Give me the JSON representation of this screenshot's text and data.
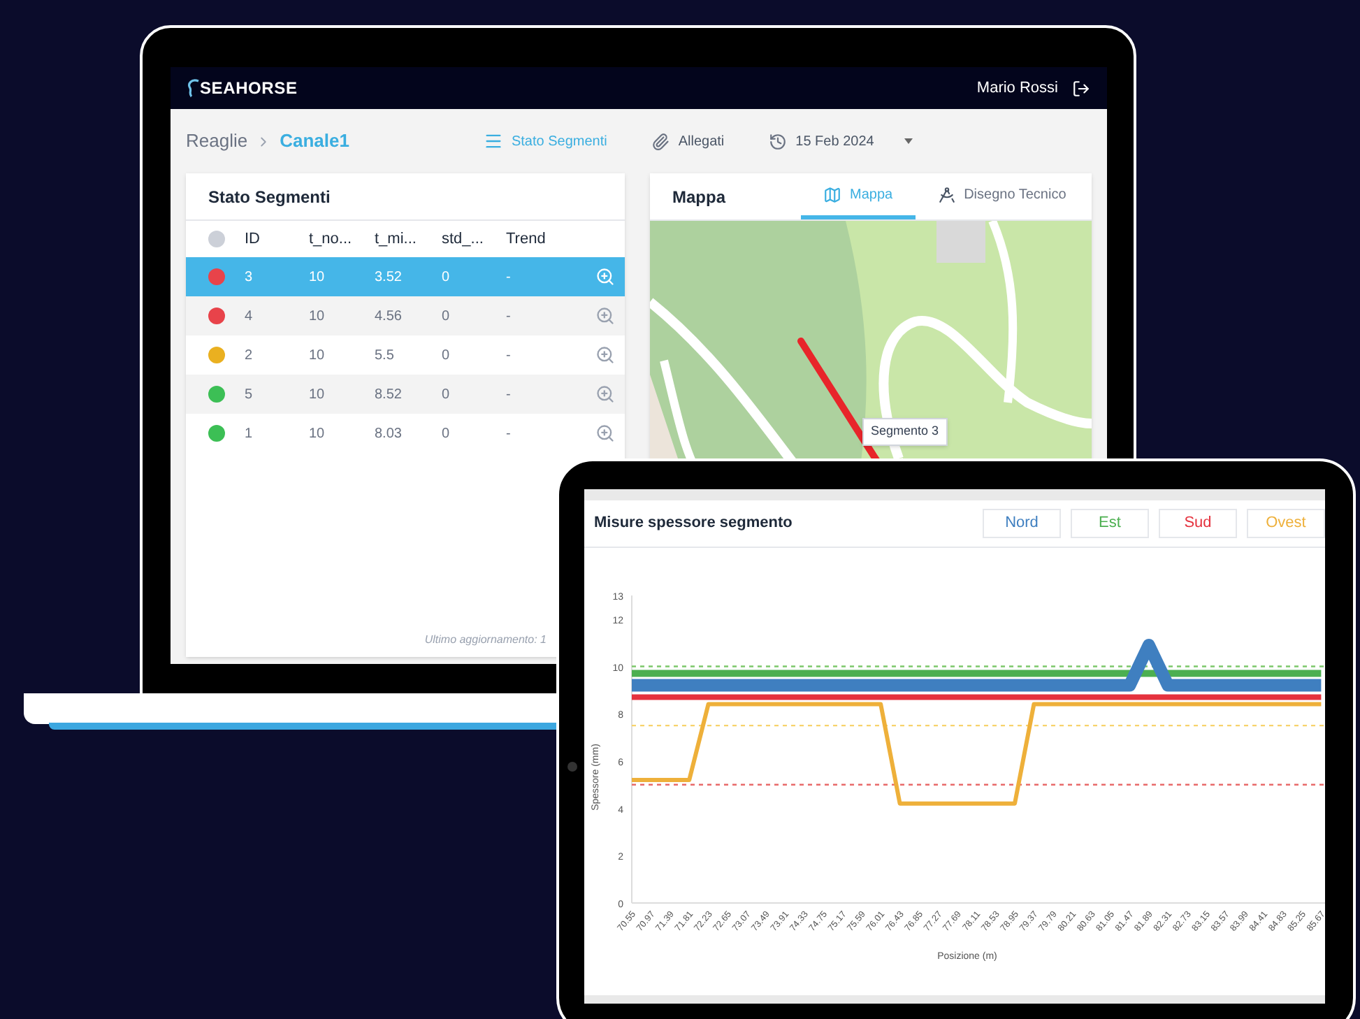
{
  "laptop": {
    "header": {
      "logo": "SEAHORSE",
      "user": "Mario Rossi"
    },
    "breadcrumb": [
      {
        "label": "Reaglie",
        "selected": false
      },
      {
        "label": "Canale1",
        "selected": true
      }
    ],
    "toolbar": [
      {
        "kind": "view",
        "label": "Stato Segmenti",
        "selected": true
      },
      {
        "kind": "attachments",
        "label": "Allegati",
        "selected": false
      },
      {
        "kind": "date",
        "label": "15 Feb 2024",
        "selected": false
      }
    ],
    "segments_panel": {
      "title": "Stato Segmenti",
      "columns": [
        "ID",
        "t_no...",
        "t_mi...",
        "std_...",
        "Trend"
      ],
      "rows": [
        {
          "color": "#e8434a",
          "selected": true,
          "cells": [
            "3",
            "10",
            "3.52",
            "0",
            "-"
          ]
        },
        {
          "color": "#e8434a",
          "selected": false,
          "cells": [
            "4",
            "10",
            "4.56",
            "0",
            "-"
          ]
        },
        {
          "color": "#eab020",
          "selected": false,
          "cells": [
            "2",
            "10",
            "5.5",
            "0",
            "-"
          ]
        },
        {
          "color": "#3cbf55",
          "selected": false,
          "cells": [
            "5",
            "10",
            "8.52",
            "0",
            "-"
          ]
        },
        {
          "color": "#3cbf55",
          "selected": false,
          "cells": [
            "1",
            "10",
            "8.03",
            "0",
            "-"
          ]
        }
      ],
      "footer": "Ultimo aggiornamento: 1"
    },
    "map_panel": {
      "title": "Mappa",
      "tabs": [
        {
          "kind": "map",
          "label": "Mappa",
          "selected": true
        },
        {
          "kind": "drawing",
          "label": "Disegno Tecnico",
          "selected": false
        }
      ],
      "tooltip": "Segmento 3"
    }
  },
  "tablet": {
    "chart_data": {
      "type": "line",
      "title": "Misure spessore segmento",
      "xlabel": "Posizione (m)",
      "ylabel": "Spessore (mm)",
      "categories": [
        "70.55",
        "70.97",
        "71.39",
        "71.81",
        "72.23",
        "72.65",
        "73.07",
        "73.49",
        "73.91",
        "74.33",
        "74.75",
        "75.17",
        "75.59",
        "76.01",
        "76.43",
        "76.85",
        "77.27",
        "77.69",
        "78.11",
        "78.53",
        "78.95",
        "79.37",
        "79.79",
        "80.21",
        "80.63",
        "81.05",
        "81.47",
        "81.89",
        "82.31",
        "82.73",
        "83.15",
        "83.57",
        "83.99",
        "84.41",
        "84.83",
        "85.25",
        "85.67"
      ],
      "series": [
        {
          "name": "Nord",
          "color": "#3f7fc0",
          "values": [
            9.2,
            9.2,
            9.2,
            9.2,
            9.2,
            9.2,
            9.2,
            9.2,
            9.2,
            9.2,
            9.2,
            9.2,
            9.2,
            9.2,
            9.2,
            9.2,
            9.2,
            9.2,
            9.2,
            9.2,
            9.2,
            9.2,
            9.2,
            9.2,
            9.2,
            9.2,
            9.2,
            10.9,
            9.2,
            9.2,
            9.2,
            9.2,
            9.2,
            9.2,
            9.2,
            9.2,
            9.2
          ]
        },
        {
          "name": "Est",
          "color": "#4caf50",
          "values": [
            9.7,
            9.7,
            9.7,
            9.7,
            9.7,
            9.7,
            9.7,
            9.7,
            9.7,
            9.7,
            9.7,
            9.7,
            9.7,
            9.7,
            9.7,
            9.7,
            9.7,
            9.7,
            9.7,
            9.7,
            9.7,
            9.7,
            9.7,
            9.7,
            9.7,
            9.7,
            9.7,
            9.7,
            9.7,
            9.7,
            9.7,
            9.7,
            9.7,
            9.7,
            9.7,
            9.7,
            9.7
          ]
        },
        {
          "name": "Sud",
          "color": "#e5323e",
          "values": [
            8.7,
            8.7,
            8.7,
            8.7,
            8.7,
            8.7,
            8.7,
            8.7,
            8.7,
            8.7,
            8.7,
            8.7,
            8.7,
            8.7,
            8.7,
            8.7,
            8.7,
            8.7,
            8.7,
            8.7,
            8.7,
            8.7,
            8.7,
            8.7,
            8.7,
            8.7,
            8.7,
            8.7,
            8.7,
            8.7,
            8.7,
            8.7,
            8.7,
            8.7,
            8.7,
            8.7,
            8.7
          ]
        },
        {
          "name": "Ovest",
          "color": "#eeb03a",
          "values": [
            5.2,
            5.2,
            5.2,
            5.2,
            8.4,
            8.4,
            8.4,
            8.4,
            8.4,
            8.4,
            8.4,
            8.4,
            8.4,
            8.4,
            4.2,
            4.2,
            4.2,
            4.2,
            4.2,
            4.2,
            4.2,
            8.4,
            8.4,
            8.4,
            8.4,
            8.4,
            8.4,
            8.4,
            8.4,
            8.4,
            8.4,
            8.4,
            8.4,
            8.4,
            8.4,
            8.4,
            8.4
          ]
        }
      ],
      "ylim": [
        0,
        13
      ],
      "yticks": [
        0,
        2,
        4,
        6,
        8,
        10,
        12,
        13
      ],
      "ref_lines": [
        {
          "axis": "y",
          "value": 10,
          "color": "#7cc86a"
        },
        {
          "axis": "y",
          "value": 7.5,
          "color": "#f7d36b"
        },
        {
          "axis": "y",
          "value": 5,
          "color": "#e86a6a"
        }
      ]
    }
  }
}
